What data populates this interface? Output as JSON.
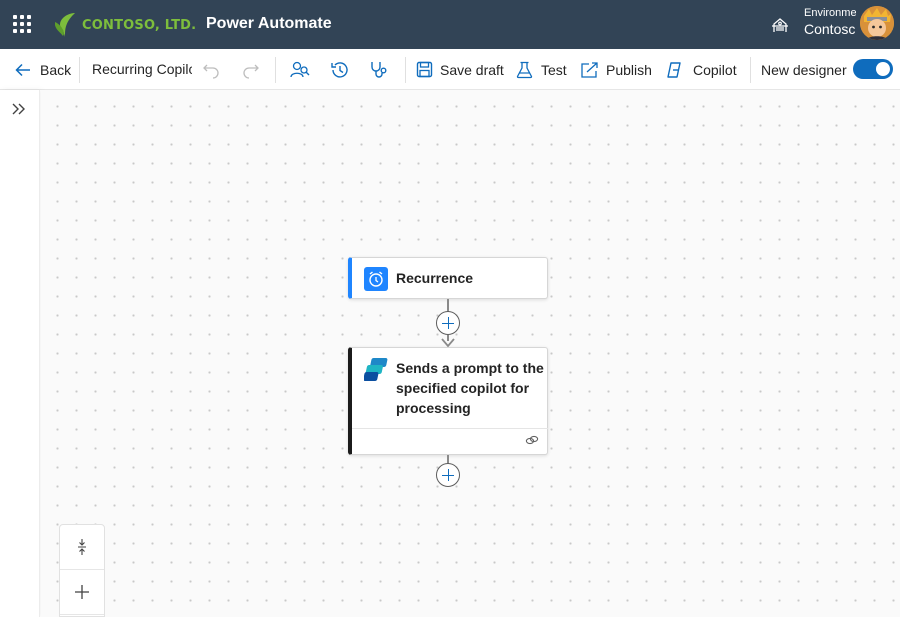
{
  "header": {
    "brand": "CONTOSO, LTD.",
    "app_title": "Power Automate",
    "environment_label": "Environme",
    "environment_name": "Contosc"
  },
  "toolbar": {
    "back_label": "Back",
    "flow_name": "Recurring Copilc",
    "save_draft_label": "Save draft",
    "test_label": "Test",
    "publish_label": "Publish",
    "copilot_label": "Copilot",
    "new_designer_label": "New designer",
    "new_designer_enabled": true
  },
  "flow": {
    "steps": [
      {
        "title": "Recurrence",
        "accent": "#1f85ff",
        "icon": "alarm-clock-icon"
      },
      {
        "title_lines": [
          "Sends a prompt to the",
          "specified copilot for",
          "processing"
        ],
        "accent": "#1b1b1b",
        "icon": "copilot-studio-icon"
      }
    ]
  },
  "colors": {
    "header_bg": "#324456",
    "accent": "#0f6cbd",
    "brand_green": "#7dbe3c"
  }
}
